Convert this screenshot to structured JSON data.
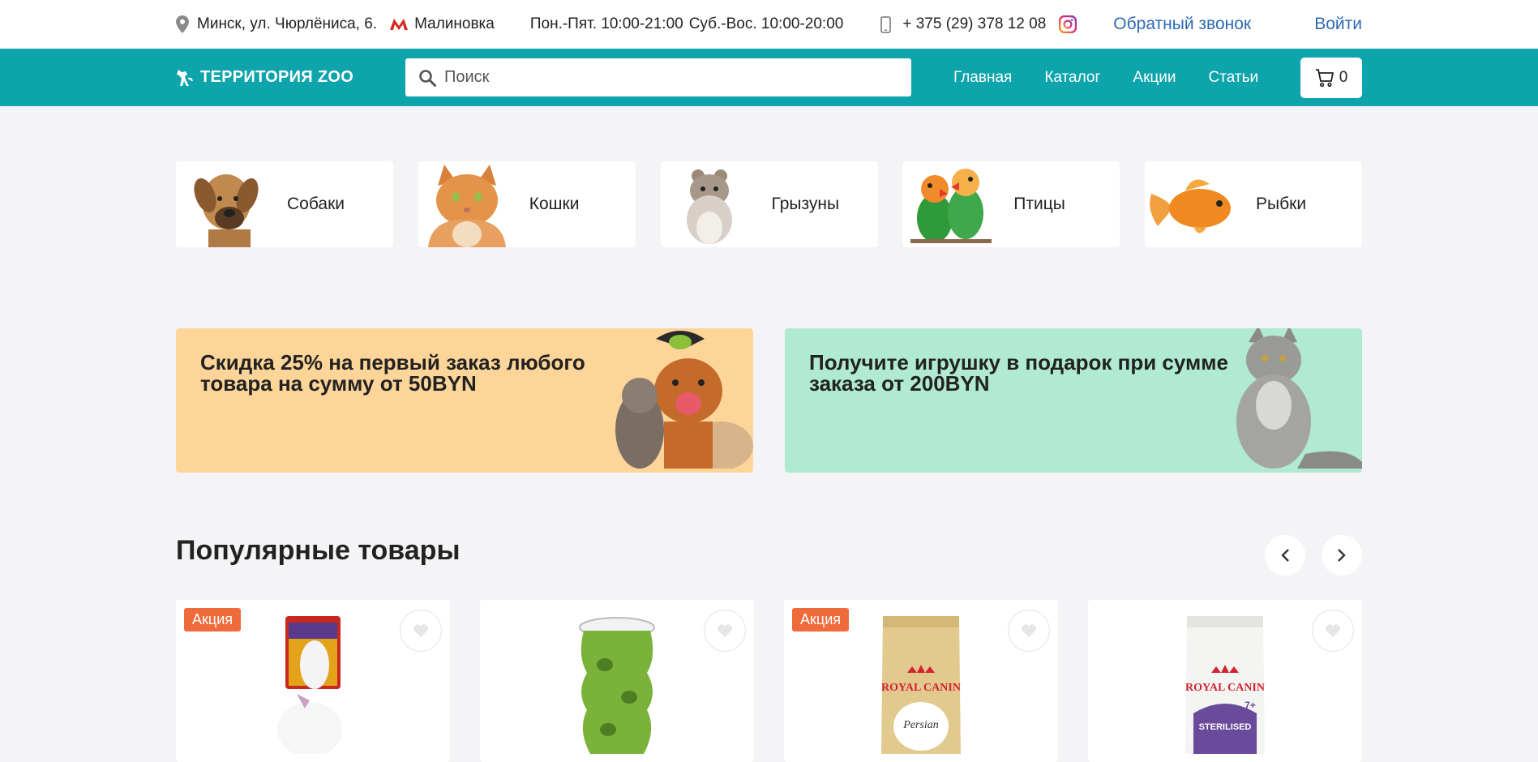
{
  "topbar": {
    "address": "Минск, ул. Чюрлёниса, 6.",
    "metro": "Малиновка",
    "hours_weekdays": "Пон.-Пят. 10:00-21:00",
    "hours_weekend": "Суб.-Вос. 10:00-20:00",
    "phone": "+ 375 (29) 378 12 08",
    "callback": "Обратный звонок",
    "login": "Войти"
  },
  "header": {
    "logo": "ТЕРРИТОРИЯ ZOO",
    "search_placeholder": "Поиск",
    "nav": [
      "Главная",
      "Каталог",
      "Акции",
      "Статьи"
    ],
    "cart_count": "0"
  },
  "categories": [
    "Собаки",
    "Кошки",
    "Грызуны",
    "Птицы",
    "Рыбки"
  ],
  "promos": [
    {
      "text": "Скидка 25% на первый заказ любого товара на сумму от 50BYN"
    },
    {
      "text": "Получите игрушку в подарок при сумме заказа от 200BYN"
    }
  ],
  "popular": {
    "title": "Популярные товары",
    "products": [
      {
        "badge": "Акция"
      },
      {
        "badge": ""
      },
      {
        "badge": "Акция"
      },
      {
        "badge": ""
      }
    ],
    "brand_label": "ROYAL CANIN",
    "product_labels": [
      "Persian",
      "STERILISED"
    ]
  },
  "colors": {
    "header_bg": "#0ea4ac",
    "link": "#2d69b4",
    "badge": "#f06b3b",
    "promo_orange": "#fed599",
    "promo_mint": "#b0ead2",
    "metro": "#d9271c"
  }
}
